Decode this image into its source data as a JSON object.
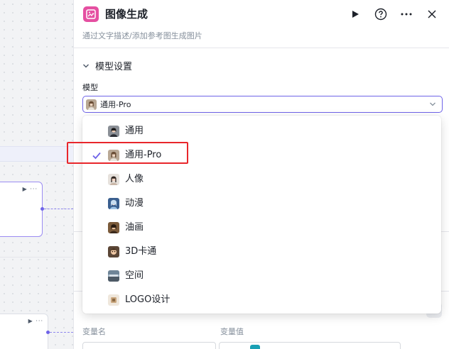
{
  "panel": {
    "title": "图像生成",
    "subtitle": "通过文字描述/添加参考图生成图片",
    "section_title": "模型设置",
    "model_label": "模型",
    "model_value": "通用-Pro",
    "variable_name_label": "变量名",
    "variable_value_label": "变量值"
  },
  "model_options": [
    {
      "label": "通用",
      "selected": false,
      "thumb": "portrait-general"
    },
    {
      "label": "通用-Pro",
      "selected": true,
      "thumb": "portrait-pro"
    },
    {
      "label": "人像",
      "selected": false,
      "thumb": "portrait-person"
    },
    {
      "label": "动漫",
      "selected": false,
      "thumb": "anime"
    },
    {
      "label": "油画",
      "selected": false,
      "thumb": "oil-painting"
    },
    {
      "label": "3D卡通",
      "selected": false,
      "thumb": "3d-cartoon"
    },
    {
      "label": "空间",
      "selected": false,
      "thumb": "space"
    },
    {
      "label": "LOGO设计",
      "selected": false,
      "thumb": "logo-design"
    }
  ],
  "colors": {
    "accent": "#6e63e8",
    "app_icon": "#e54fa1",
    "annotation": "#e8262b"
  }
}
